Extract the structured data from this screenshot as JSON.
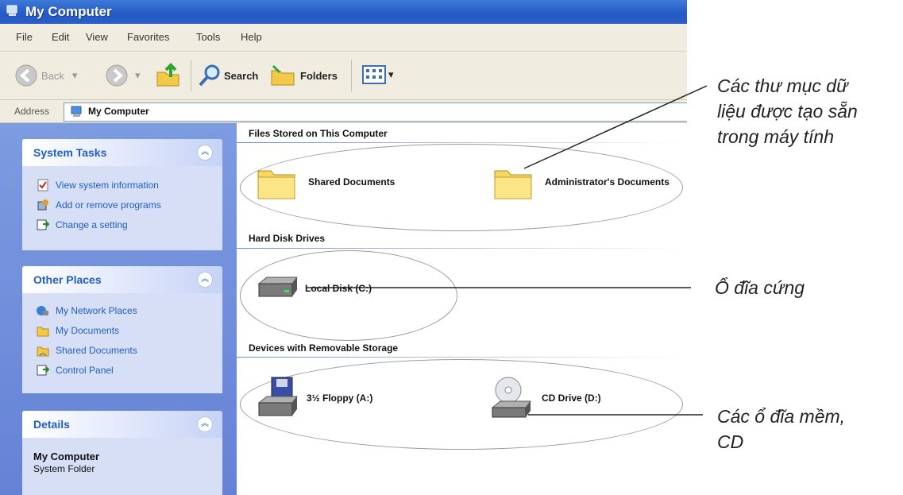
{
  "window": {
    "title": "My Computer"
  },
  "menu": [
    "File",
    "Edit",
    "View",
    "Favorites",
    "Tools",
    "Help"
  ],
  "toolbar": {
    "back": "Back",
    "search": "Search",
    "folders": "Folders"
  },
  "address": {
    "label": "Address",
    "value": "My Computer"
  },
  "sidebar": {
    "system_tasks": {
      "title": "System Tasks",
      "items": [
        "View system information",
        "Add or remove programs",
        "Change a setting"
      ]
    },
    "other_places": {
      "title": "Other Places",
      "items": [
        "My Network Places",
        "My Documents",
        "Shared Documents",
        "Control Panel"
      ]
    },
    "details": {
      "title": "Details",
      "name": "My Computer",
      "type": "System Folder"
    }
  },
  "main": {
    "files_stored": {
      "header": "Files Stored on This Computer",
      "items": [
        "Shared Documents",
        "Administrator's Documents"
      ]
    },
    "hard_disks": {
      "header": "Hard Disk Drives",
      "items": [
        "Local Disk (C:)"
      ]
    },
    "removable": {
      "header": "Devices with Removable Storage",
      "items": [
        "3½ Floppy (A:)",
        "CD Drive (D:)"
      ]
    }
  },
  "annotations": {
    "folders": [
      "Các thư mục dữ",
      "liệu được tạo sẵn",
      "trong máy tính"
    ],
    "hdd": [
      "Ổ đĩa cứng"
    ],
    "removable": [
      "Các ổ đĩa mềm,",
      "CD"
    ]
  },
  "colors": {
    "titlebar": "#2559c4",
    "sidebar": "#7c9be0",
    "link": "#215dc6"
  }
}
